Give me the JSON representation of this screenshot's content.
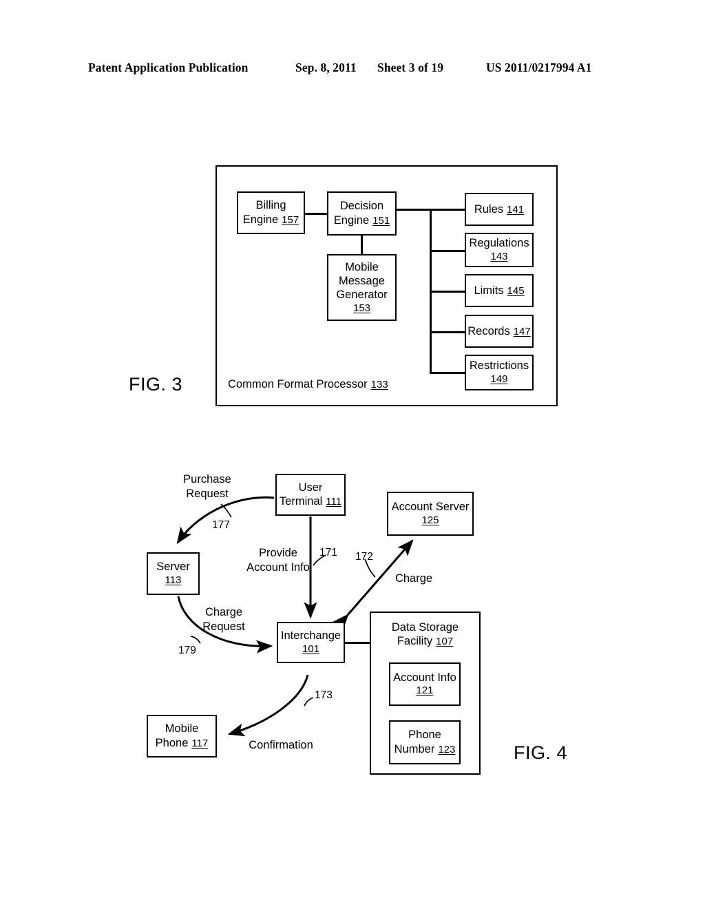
{
  "header": {
    "publication": "Patent Application Publication",
    "date": "Sep. 8, 2011",
    "sheet": "Sheet 3 of 19",
    "patent_number": "US 2011/0217994 A1"
  },
  "fig3": {
    "label": "FIG. 3",
    "caption_text": "Common Format Processor",
    "caption_ref": "133",
    "boxes": {
      "billing_engine": {
        "line1": "Billing",
        "line2": "Engine",
        "ref": "157"
      },
      "decision_engine": {
        "line1": "Decision",
        "line2": "Engine",
        "ref": "151"
      },
      "mobile_message_generator": {
        "line1": "Mobile",
        "line2": "Message",
        "line3": "Generator",
        "ref": "153"
      },
      "rules": {
        "line1": "Rules",
        "ref": "141"
      },
      "regulations": {
        "line1": "Regulations",
        "ref": "143"
      },
      "limits": {
        "line1": "Limits",
        "ref": "145"
      },
      "records": {
        "line1": "Records",
        "ref": "147"
      },
      "restrictions": {
        "line1": "Restrictions",
        "ref": "149"
      }
    }
  },
  "fig4": {
    "label": "FIG. 4",
    "boxes": {
      "user_terminal": {
        "line1": "User",
        "line2": "Terminal",
        "ref": "111"
      },
      "account_server": {
        "line1": "Account Server",
        "ref": "125"
      },
      "server": {
        "line1": "Server",
        "ref": "113"
      },
      "interchange": {
        "line1": "Interchange",
        "ref": "101"
      },
      "data_storage_facility": {
        "line1": "Data Storage",
        "line2": "Facility",
        "ref": "107"
      },
      "account_info": {
        "line1": "Account Info",
        "ref": "121"
      },
      "phone_number": {
        "line1": "Phone",
        "line2": "Number",
        "ref": "123"
      },
      "mobile_phone": {
        "line1": "Mobile",
        "line2": "Phone",
        "ref": "117"
      }
    },
    "flows": {
      "purchase_request": {
        "line1": "Purchase",
        "line2": "Request",
        "ref": "177"
      },
      "provide_account_info": {
        "line1": "Provide",
        "line2": "Account Info",
        "ref": "171"
      },
      "charge": {
        "line1": "Charge",
        "ref": "172"
      },
      "charge_request": {
        "line1": "Charge",
        "line2": "Request",
        "ref": "179"
      },
      "confirmation": {
        "line1": "Confirmation",
        "ref": "173"
      }
    }
  }
}
